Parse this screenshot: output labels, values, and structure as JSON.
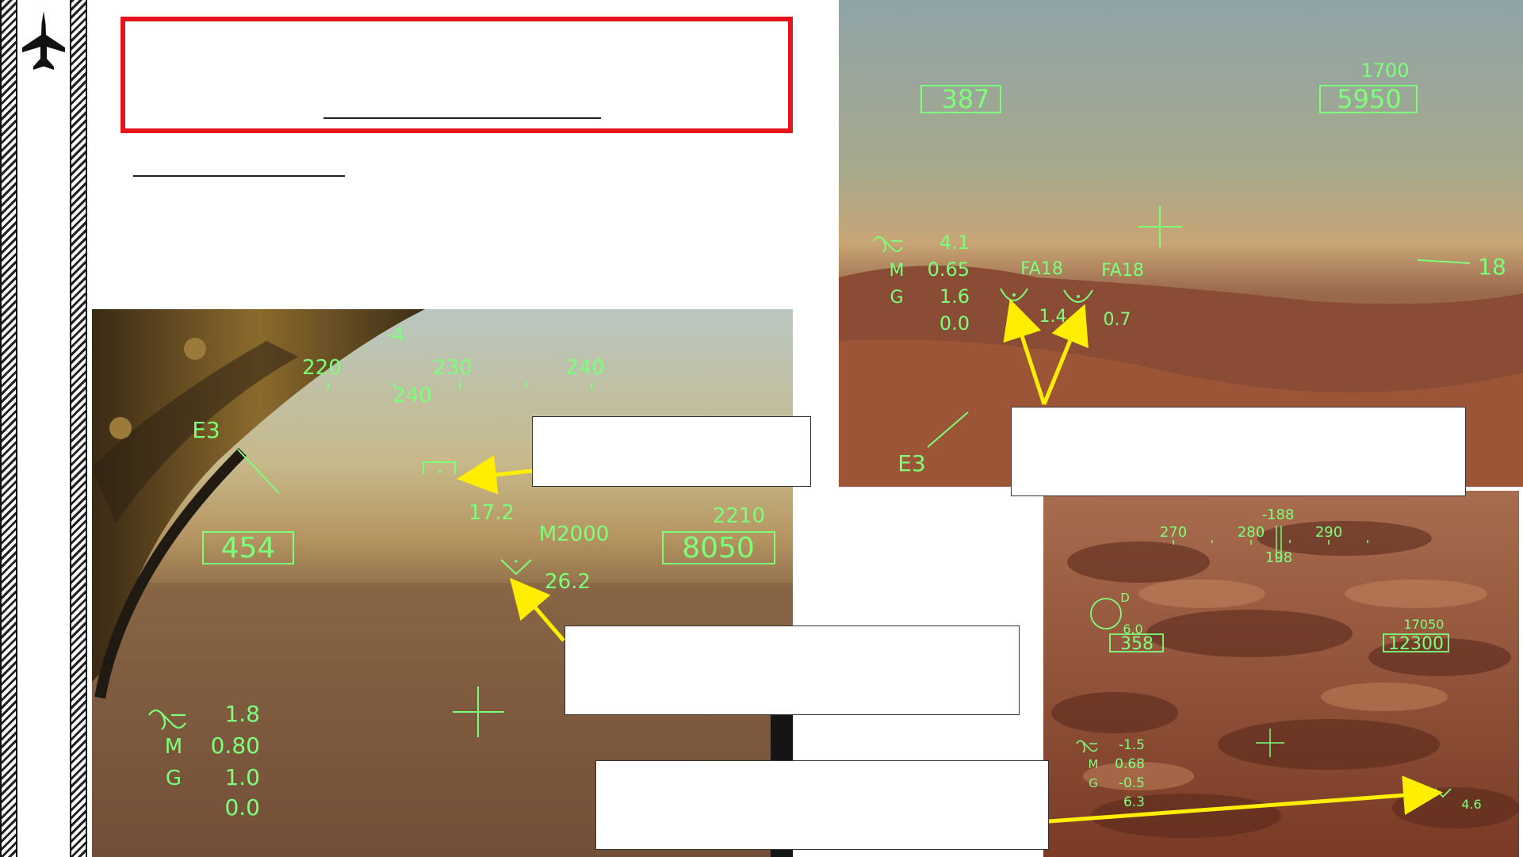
{
  "colors": {
    "accent_red": "#e8141b",
    "hud_green": "#7dff7a",
    "arrow_yellow": "#ffee00"
  },
  "sidebar": {
    "icon": "fighter-jet-icon"
  },
  "panel_left": {
    "heading_tape": [
      "220",
      "230",
      "240"
    ],
    "heading_above": "-4",
    "heading_value": "240",
    "target_label": "E3",
    "airspeed": "454",
    "altitude_label": "2210",
    "altitude": "8050",
    "range": "17.2",
    "target_name": "M2000",
    "target_range": "26.2",
    "alpha": "1.8",
    "mach": "0.80",
    "g": "1.0",
    "extra": "0.0"
  },
  "panel_top_right": {
    "airspeed": "387",
    "altitude_label": "1700",
    "altitude": "5950",
    "alpha": "4.1",
    "mach": "0.65",
    "g": "1.6",
    "extra": "0.0",
    "target1_name": "FA18",
    "target1_range": "1.4",
    "target2_name": "FA18",
    "target2_range": "0.7",
    "target_label": "E3",
    "pitch_ladder": "18"
  },
  "panel_bottom_right": {
    "heading_tape": [
      "270",
      "280",
      "290"
    ],
    "heading_above": "-188",
    "heading_value": "198",
    "designator_label": "D",
    "designator_value": "6.0",
    "airspeed": "358",
    "altitude_label": "17050",
    "altitude": "12300",
    "alpha": "-1.5",
    "mach": "0.68",
    "g": "-0.5",
    "extra": "6.3",
    "target_range": "4.6"
  }
}
